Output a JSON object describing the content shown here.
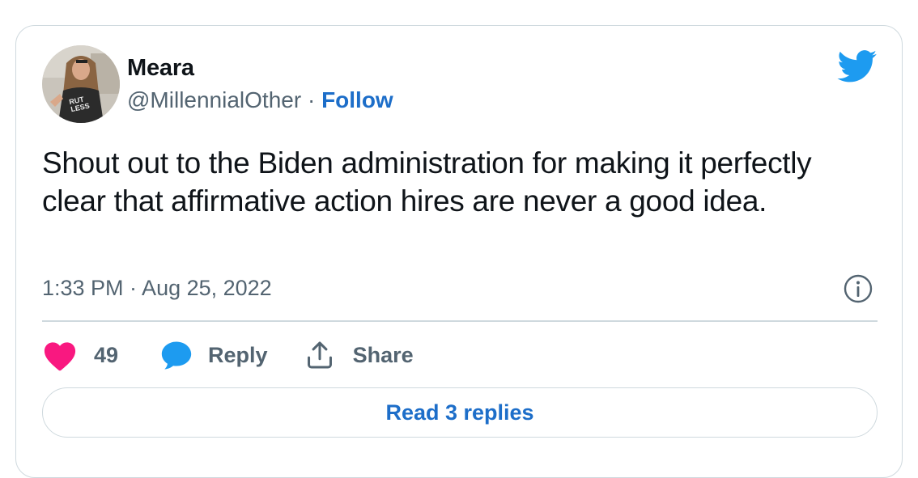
{
  "tweet": {
    "author_name": "Meara",
    "handle": "@MillennialOther",
    "separator": " · ",
    "follow_label": "Follow",
    "text": "Shout out to the Biden administration for making it perfectly clear that affirmative action hires are never a good idea.",
    "timestamp": "1:33 PM · Aug 25, 2022",
    "avatar_shirt_text": "RUTHLESS"
  },
  "actions": {
    "like_count": "49",
    "reply_label": "Reply",
    "share_label": "Share"
  },
  "footer": {
    "read_replies_label": "Read 3 replies"
  },
  "icons": {
    "brand": "twitter-bird-icon",
    "info": "info-icon",
    "like": "heart-icon",
    "reply": "speech-bubble-icon",
    "share": "share-icon"
  },
  "colors": {
    "twitter_blue": "#1d9bf0",
    "link_blue": "#1d6ec9",
    "heart_pink": "#f91880",
    "reply_blue": "#1d9bf0",
    "secondary_text": "#536471",
    "border": "#cfd9de"
  }
}
